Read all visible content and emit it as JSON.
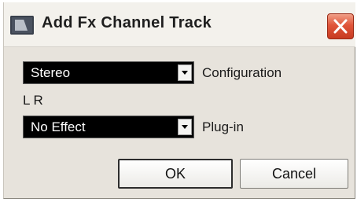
{
  "window": {
    "title": "Add Fx Channel Track",
    "close_icon": "close-x-icon"
  },
  "configuration": {
    "selected": "Stereo",
    "label": "Configuration"
  },
  "channel_info": "L R",
  "plugin": {
    "selected": "No Effect",
    "label": "Plug-in"
  },
  "buttons": {
    "ok": "OK",
    "cancel": "Cancel"
  },
  "colors": {
    "dialog_bg": "#e7e3dc",
    "dropdown_bg": "#000000",
    "close_red": "#e0553a"
  }
}
